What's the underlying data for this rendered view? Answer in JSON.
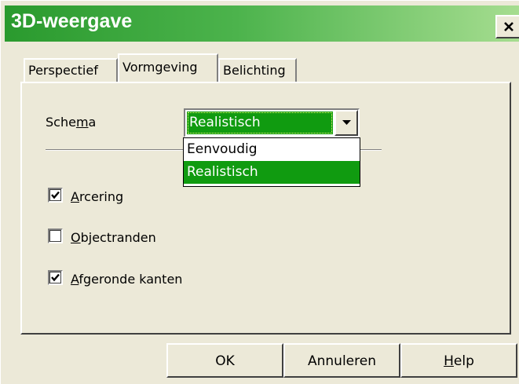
{
  "window": {
    "title": "3D-weergave"
  },
  "tabs": [
    {
      "label": "Perspectief",
      "active": false
    },
    {
      "label": "Vormgeving",
      "active": true
    },
    {
      "label": "Belichting",
      "active": false
    }
  ],
  "scheme": {
    "label_pre": "Sche",
    "label_accel": "m",
    "label_post": "a",
    "selected": "Realistisch",
    "options": [
      "Eenvoudig",
      "Realistisch"
    ],
    "highlighted_index": 1
  },
  "checkboxes": [
    {
      "accel": "A",
      "rest": "rcering",
      "checked": true
    },
    {
      "accel": "O",
      "rest": "bjectranden",
      "checked": false
    },
    {
      "accel": "A",
      "rest": "fgeronde kanten",
      "checked": true
    }
  ],
  "buttons": {
    "ok": "OK",
    "cancel": "Annuleren",
    "help_accel": "H",
    "help_rest": "elp"
  },
  "colors": {
    "title_gradient_start": "#2a9a2e",
    "title_gradient_end": "#a6dd90",
    "selection": "#109b10",
    "face": "#ece9d8"
  },
  "icons": {
    "close": "close-icon",
    "dropdown": "chevron-down-icon",
    "check": "checkmark-icon"
  }
}
